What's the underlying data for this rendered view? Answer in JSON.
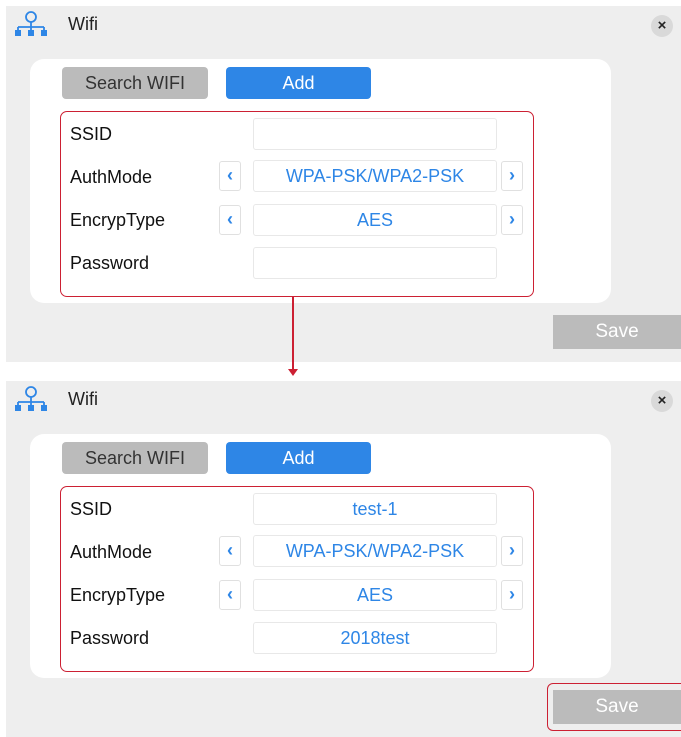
{
  "colors": {
    "accent": "#2e86e6",
    "highlight": "#cc2033",
    "panel_bg": "#eeeeee",
    "button_gray": "#bbbbbb"
  },
  "panels": [
    {
      "title": "Wifi",
      "close_label": "×",
      "search_label": "Search WIFI",
      "add_label": "Add",
      "form": {
        "ssid_label": "SSID",
        "ssid_value": "",
        "auth_label": "AuthMode",
        "auth_value": "WPA-PSK/WPA2-PSK",
        "encryp_label": "EncrypType",
        "encryp_value": "AES",
        "password_label": "Password",
        "password_value": ""
      },
      "prev_icon": "‹",
      "next_icon": "›",
      "save_label": "Save"
    },
    {
      "title": "Wifi",
      "close_label": "×",
      "search_label": "Search WIFI",
      "add_label": "Add",
      "form": {
        "ssid_label": "SSID",
        "ssid_value": "test-1",
        "auth_label": "AuthMode",
        "auth_value": "WPA-PSK/WPA2-PSK",
        "encryp_label": "EncrypType",
        "encryp_value": "AES",
        "password_label": "Password",
        "password_value": "2018test"
      },
      "prev_icon": "‹",
      "next_icon": "›",
      "save_label": "Save"
    }
  ]
}
